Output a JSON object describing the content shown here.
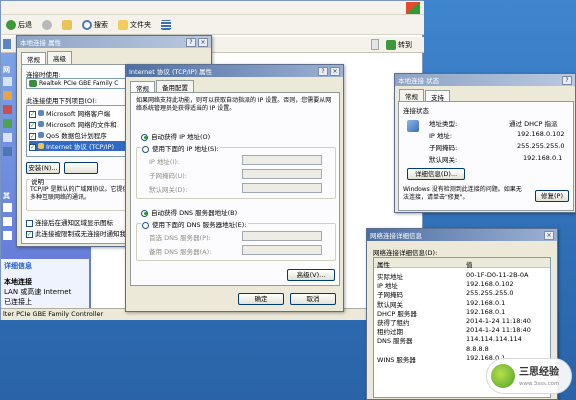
{
  "explorer": {
    "back_label": "后退",
    "search_label": "搜索",
    "folders_label": "文件夹",
    "go_label": "转到",
    "left_letters": [
      "网",
      "其"
    ],
    "left_items": [
      "详细信息"
    ],
    "details_title": "本地连接",
    "details_line1": "LAN 或高速 Internet",
    "details_line2": "已连接上",
    "status_text": "lter PCIe GBE Family Controller"
  },
  "lan_props": {
    "title": "本地连接 属性",
    "tabs": [
      "常规",
      "高级"
    ],
    "connect_using_label": "连接时使用:",
    "adapter_name": "Realtek PCIe GBE Family C",
    "items_label": "此连接使用下列项目(O):",
    "items": [
      "Microsoft 网络客户端",
      "Microsoft 网络的文件和",
      "QoS 数据包计划程序",
      "Internet 协议 (TCP/IP)"
    ],
    "install_button": "安装(N)...",
    "desc_title": "说明",
    "desc_text": "TCP/IP 是默认的广域网协议。它提供跨越多种互联网络的通讯。",
    "show_icon_label": "连接后在通知区域显示图标",
    "notify_label": "此连接被限制或无连接时通知我"
  },
  "tcpip": {
    "title": "Internet 协议 (TCP/IP) 属性",
    "tabs": [
      "常规",
      "备用配置"
    ],
    "intro": "如果网络支持此功能，则可以获取自动指派的 IP 设置。否则，您需要从网络系统管理员处获得适当的 IP 设置。",
    "auto_ip_label": "自动获得 IP 地址(O)",
    "manual_ip_label": "使用下面的 IP 地址(S):",
    "ip_label": "IP 地址(I):",
    "mask_label": "子网掩码(U):",
    "gateway_label": "默认网关(D):",
    "auto_dns_label": "自动获得 DNS 服务器地址(B)",
    "manual_dns_label": "使用下面的 DNS 服务器地址(E):",
    "dns1_label": "首选 DNS 服务器(P):",
    "dns2_label": "备用 DNS 服务器(A):",
    "advanced_button": "高级(V)...",
    "ok_button": "确定",
    "cancel_button": "取消"
  },
  "status_win": {
    "title": "本地连接 状态",
    "tabs": [
      "常规",
      "支持"
    ],
    "group_title": "连接状态",
    "rows": [
      {
        "label": "地址类型:",
        "value": "通过 DHCP 指派"
      },
      {
        "label": "IP 地址:",
        "value": "192.168.0.102"
      },
      {
        "label": "子网掩码:",
        "value": "255.255.255.0"
      },
      {
        "label": "默认网关:",
        "value": "192.168.0.1"
      }
    ],
    "details_button": "详细信息(D)...",
    "footer_text": "Windows 没有检测到此连接的问题。如果无法连接，请单击\"修复\"。",
    "repair_button": "修复(P)"
  },
  "details_win": {
    "title": "网络连接详细信息",
    "subtitle": "网络连接详细信息(D):",
    "col_property": "属性",
    "col_value": "值",
    "rows": [
      {
        "p": "实际地址",
        "v": "00-1F-D0-11-2B-0A"
      },
      {
        "p": "IP 地址",
        "v": "192.168.0.102"
      },
      {
        "p": "子网掩码",
        "v": "255.255.255.0"
      },
      {
        "p": "默认网关",
        "v": "192.168.0.1"
      },
      {
        "p": "DHCP 服务器",
        "v": "192.168.0.1"
      },
      {
        "p": "获得了租约",
        "v": "2014-1-24 11:18:40"
      },
      {
        "p": "租约过期",
        "v": "2014-1-24 11:18:40"
      },
      {
        "p": "DNS 服务器",
        "v": "114.114.114.114"
      },
      {
        "p": "",
        "v": "8.8.8.8"
      },
      {
        "p": "WINS 服务器",
        "v": "192.168.0.1"
      }
    ]
  },
  "watermark": {
    "text": "三思经验",
    "url": "www.3sss.com"
  },
  "colors": {
    "desktop": "#2f6fb6",
    "dialog": "#ece9d8",
    "xp_sidebar": "#6375d6"
  }
}
